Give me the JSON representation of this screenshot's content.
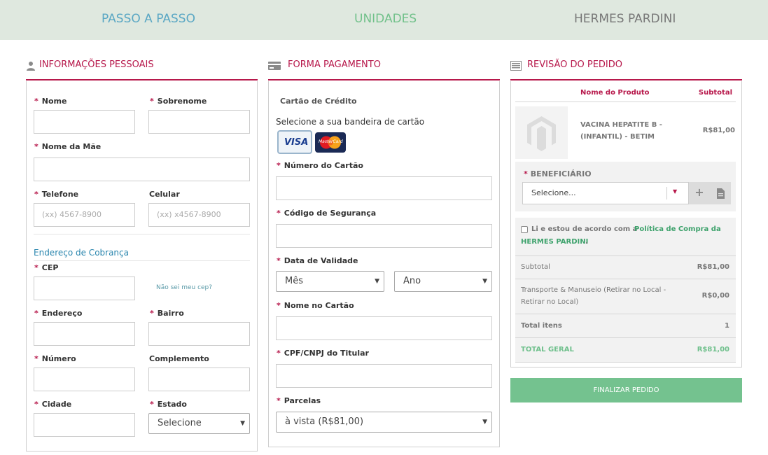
{
  "nav": {
    "passo": "PASSO A PASSO",
    "unidades": "UNIDADES",
    "hermes": "HERMES PARDINI"
  },
  "personal": {
    "title": "INFORMAÇÕES PESSOAIS",
    "nome": "Nome",
    "sobrenome": "Sobrenome",
    "nome_mae": "Nome da Mãe",
    "telefone": "Telefone",
    "telefone_placeholder": "(xx) 4567-8900",
    "celular": "Celular",
    "celular_placeholder": "(xx) x4567-8900",
    "endereco_cobranca": "Endereço de Cobrança",
    "cep": "CEP",
    "nao_sei_cep": "Não sei meu cep?",
    "endereco": "Endereço",
    "bairro": "Bairro",
    "numero": "Número",
    "complemento": "Complemento",
    "cidade": "Cidade",
    "estado": "Estado",
    "estado_value": "Selecione"
  },
  "payment": {
    "title": "FORMA PAGAMENTO",
    "cartao_credito": "Cartão de Crédito",
    "selecione_bandeira": "Selecione a sua bandeira de cartão",
    "visa": "VISA",
    "mastercard": "MasterCard",
    "numero_cartao": "Número do Cartão",
    "codigo_seguranca": "Código de Segurança",
    "data_validade": "Data de Validade",
    "mes_value": "Mês",
    "ano_value": "Ano",
    "nome_cartao": "Nome no Cartão",
    "cpf_cnpj": "CPF/CNPJ do Titular",
    "parcelas": "Parcelas",
    "parcelas_value": "à vista (R$81,00)"
  },
  "review": {
    "title": "REVISÃO DO PEDIDO",
    "col_produto": "Nome do Produto",
    "col_subtotal": "Subtotal",
    "product_line1": "VACINA HEPATITE B -",
    "product_line2": "(INFANTIL) - BETIM",
    "product_price": "R$81,00",
    "beneficiario": "BENEFICIÁRIO",
    "beneficiario_value": "Selecione...",
    "terms_prefix": "Li e estou de acordo com a",
    "terms_link1": "Política de Compra da",
    "terms_link2": "HERMES PARDINI",
    "terms_suffix": ".",
    "subtotal_label": "Subtotal",
    "subtotal_value": "R$81,00",
    "transporte_line1": "Transporte & Manuseio (Retirar no Local -",
    "transporte_line2": "Retirar no Local)",
    "transporte_value": "R$0,00",
    "total_itens_label": "Total itens",
    "total_itens_value": "1",
    "total_geral_label": "TOTAL GERAL",
    "total_geral_value": "R$81,00"
  },
  "actions": {
    "finalizar": "FINALIZAR PEDIDO"
  },
  "colors": {
    "accent": "#b7184b",
    "green": "#74c28f",
    "link_blue": "#2a86ae"
  }
}
